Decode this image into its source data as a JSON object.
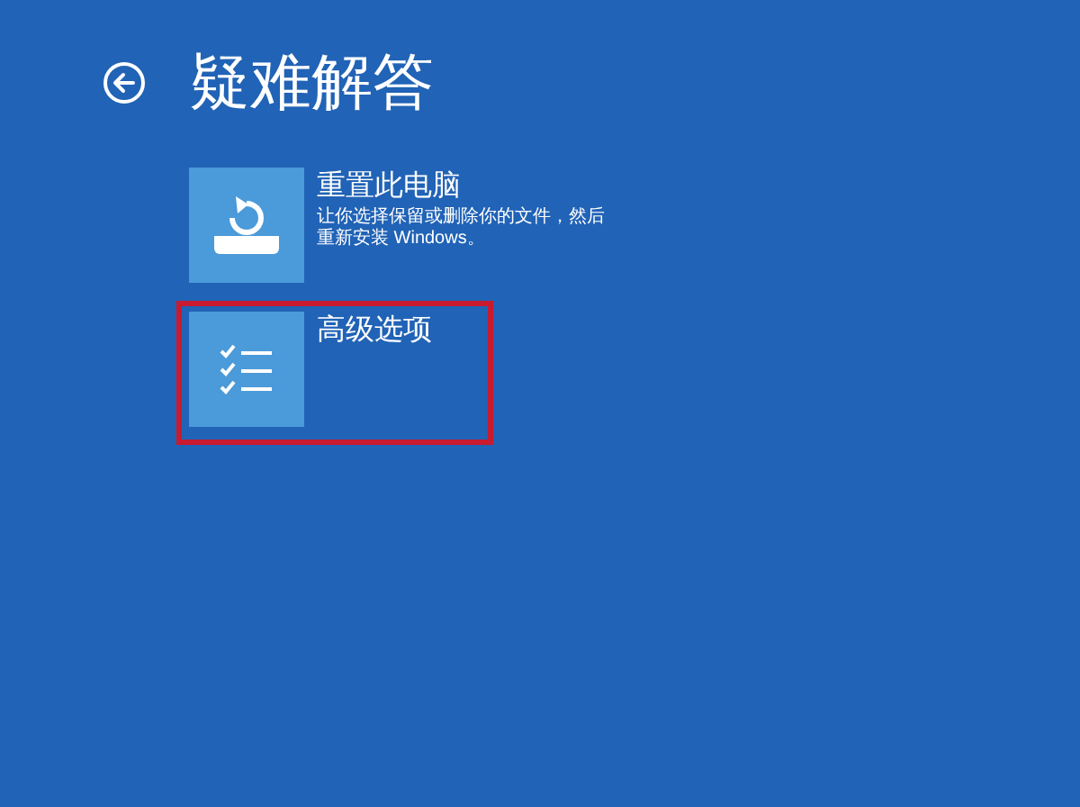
{
  "header": {
    "title": "疑难解答"
  },
  "options": [
    {
      "kind": "reset",
      "title": "重置此电脑",
      "description": "让你选择保留或删除你的文件，然后重新安装 Windows。",
      "highlighted": false
    },
    {
      "kind": "advanced",
      "title": "高级选项",
      "highlighted": true
    }
  ]
}
